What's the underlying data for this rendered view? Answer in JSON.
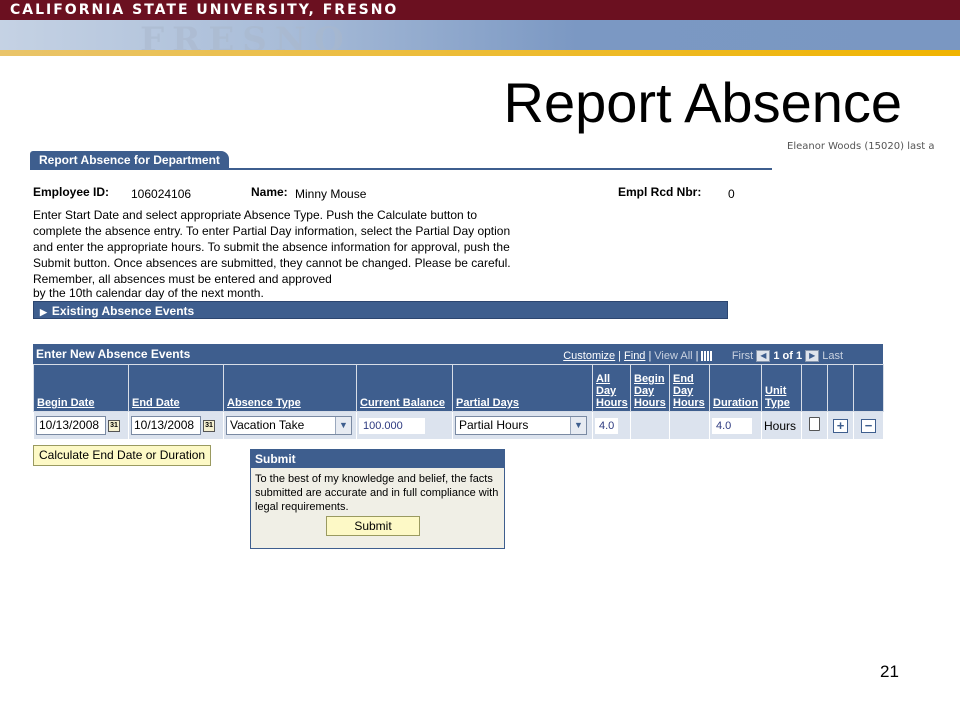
{
  "banner": {
    "university": "CALIFORNIA STATE UNIVERSITY, FRESNO",
    "seal_text": "FRESNO"
  },
  "slide": {
    "title": "Report Absence",
    "page_number": "21"
  },
  "user_info": "Eleanor Woods (15020) last a",
  "tab": {
    "label": "Report Absence for Department"
  },
  "employee": {
    "id_label": "Employee ID:",
    "id_value": "106024106",
    "name_label": "Name:",
    "name_value": "Minny Mouse",
    "rcd_label": "Empl Rcd Nbr:",
    "rcd_value": "0"
  },
  "instructions": {
    "text": "Enter Start Date and select appropriate Absence Type. Push the Calculate button to complete the absence entry. To enter Partial Day information, select the Partial Day option and enter the appropriate hours. To submit the absence information for approval, push the Submit button. Once absences are submitted, they cannot be changed. Please be careful. Remember, all absences must be entered and approved",
    "last_line": "by the 10th calendar day of the next month."
  },
  "existing_events": {
    "label": "Existing Absence Events",
    "icon": "triangle-right-icon"
  },
  "grid": {
    "title": "Enter New Absence Events",
    "nav": {
      "customize": "Customize",
      "find": "Find",
      "view_all": "View All",
      "first": "First",
      "range": "1 of 1",
      "last": "Last"
    },
    "columns": [
      "Begin Date",
      "End Date",
      "Absence Type",
      "Current Balance",
      "Partial Days",
      "All Day Hours",
      "Begin Day Hours",
      "End Day Hours",
      "Duration",
      "Unit Type"
    ],
    "row": {
      "begin_date": "10/13/2008",
      "end_date": "10/13/2008",
      "absence_type": "Vacation Take",
      "current_balance": "100.000",
      "partial_days": "Partial Hours",
      "all_day_hours": "4.0",
      "begin_day_hours": "",
      "end_day_hours": "",
      "duration": "4.0",
      "unit_type": "Hours"
    },
    "calendar_icon_text": "31"
  },
  "calc_button": {
    "label": "Calculate End Date or Duration"
  },
  "submit": {
    "heading": "Submit",
    "text": "To the best of my knowledge and belief, the facts submitted are accurate and in full compliance with legal requirements.",
    "button_label": "Submit"
  },
  "colors": {
    "header_blue": "#3e5e8e",
    "banner_maroon": "#6b1020",
    "row_bg": "#dce3ee",
    "button_yellow": "#fdf9c6"
  }
}
